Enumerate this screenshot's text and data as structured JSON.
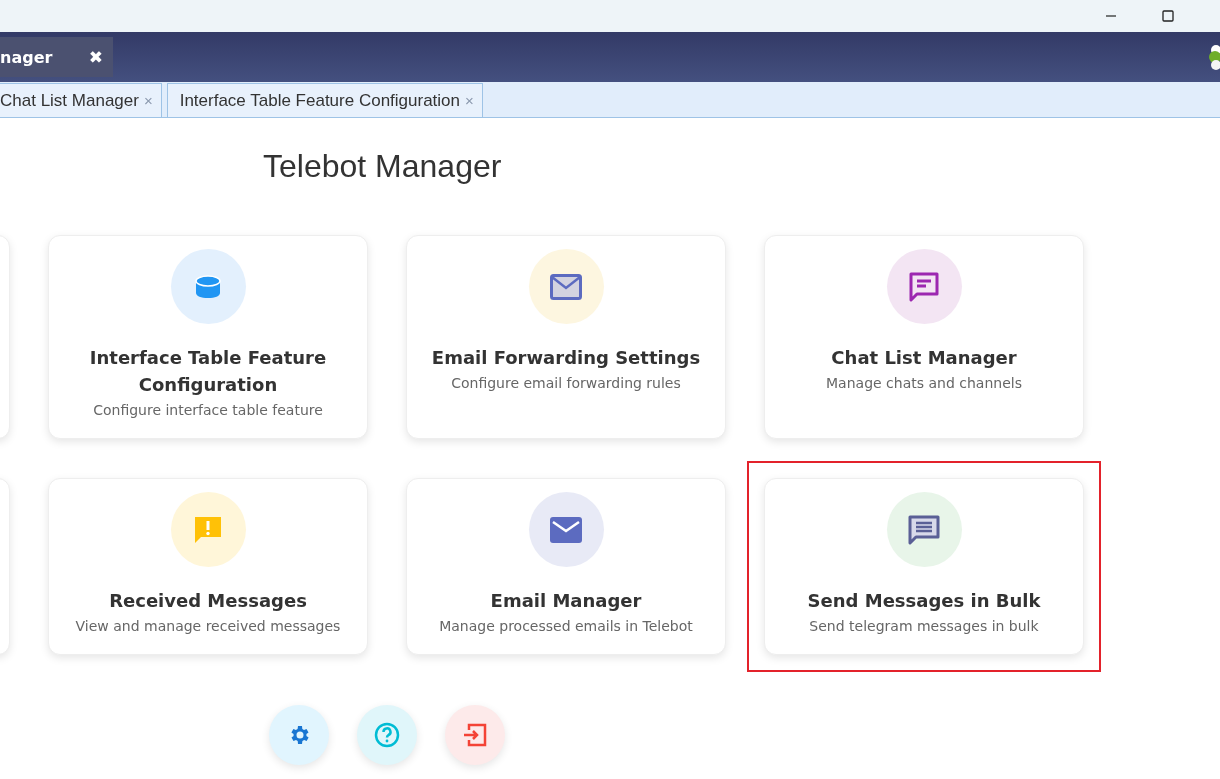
{
  "header_tab": {
    "label": "nager",
    "close": "✖"
  },
  "tabs": [
    {
      "label": "Chat List Manager",
      "close": "×"
    },
    {
      "label": "Interface Table Feature Configuration",
      "close": "×"
    }
  ],
  "title": "Telebot Manager",
  "cards": [
    {
      "kind": "database",
      "title": "Interface Table Feature Configuration",
      "subtitle": "Configure interface table feature",
      "highlighted": false
    },
    {
      "kind": "envelope-outline",
      "title": "Email Forwarding Settings",
      "subtitle": "Configure email forwarding rules",
      "highlighted": false
    },
    {
      "kind": "chat-outline",
      "title": "Chat List Manager",
      "subtitle": "Manage chats and channels",
      "highlighted": false
    },
    {
      "kind": "alert",
      "title": "Received Messages",
      "subtitle": "View and manage received messages",
      "highlighted": false
    },
    {
      "kind": "envelope",
      "title": "Email Manager",
      "subtitle": "Manage processed emails in Telebot",
      "highlighted": false
    },
    {
      "kind": "message",
      "title": "Send Messages in Bulk",
      "subtitle": "Send telegram messages in bulk",
      "highlighted": true
    }
  ],
  "actions": [
    {
      "kind": "settings"
    },
    {
      "kind": "help"
    },
    {
      "kind": "logout"
    }
  ]
}
